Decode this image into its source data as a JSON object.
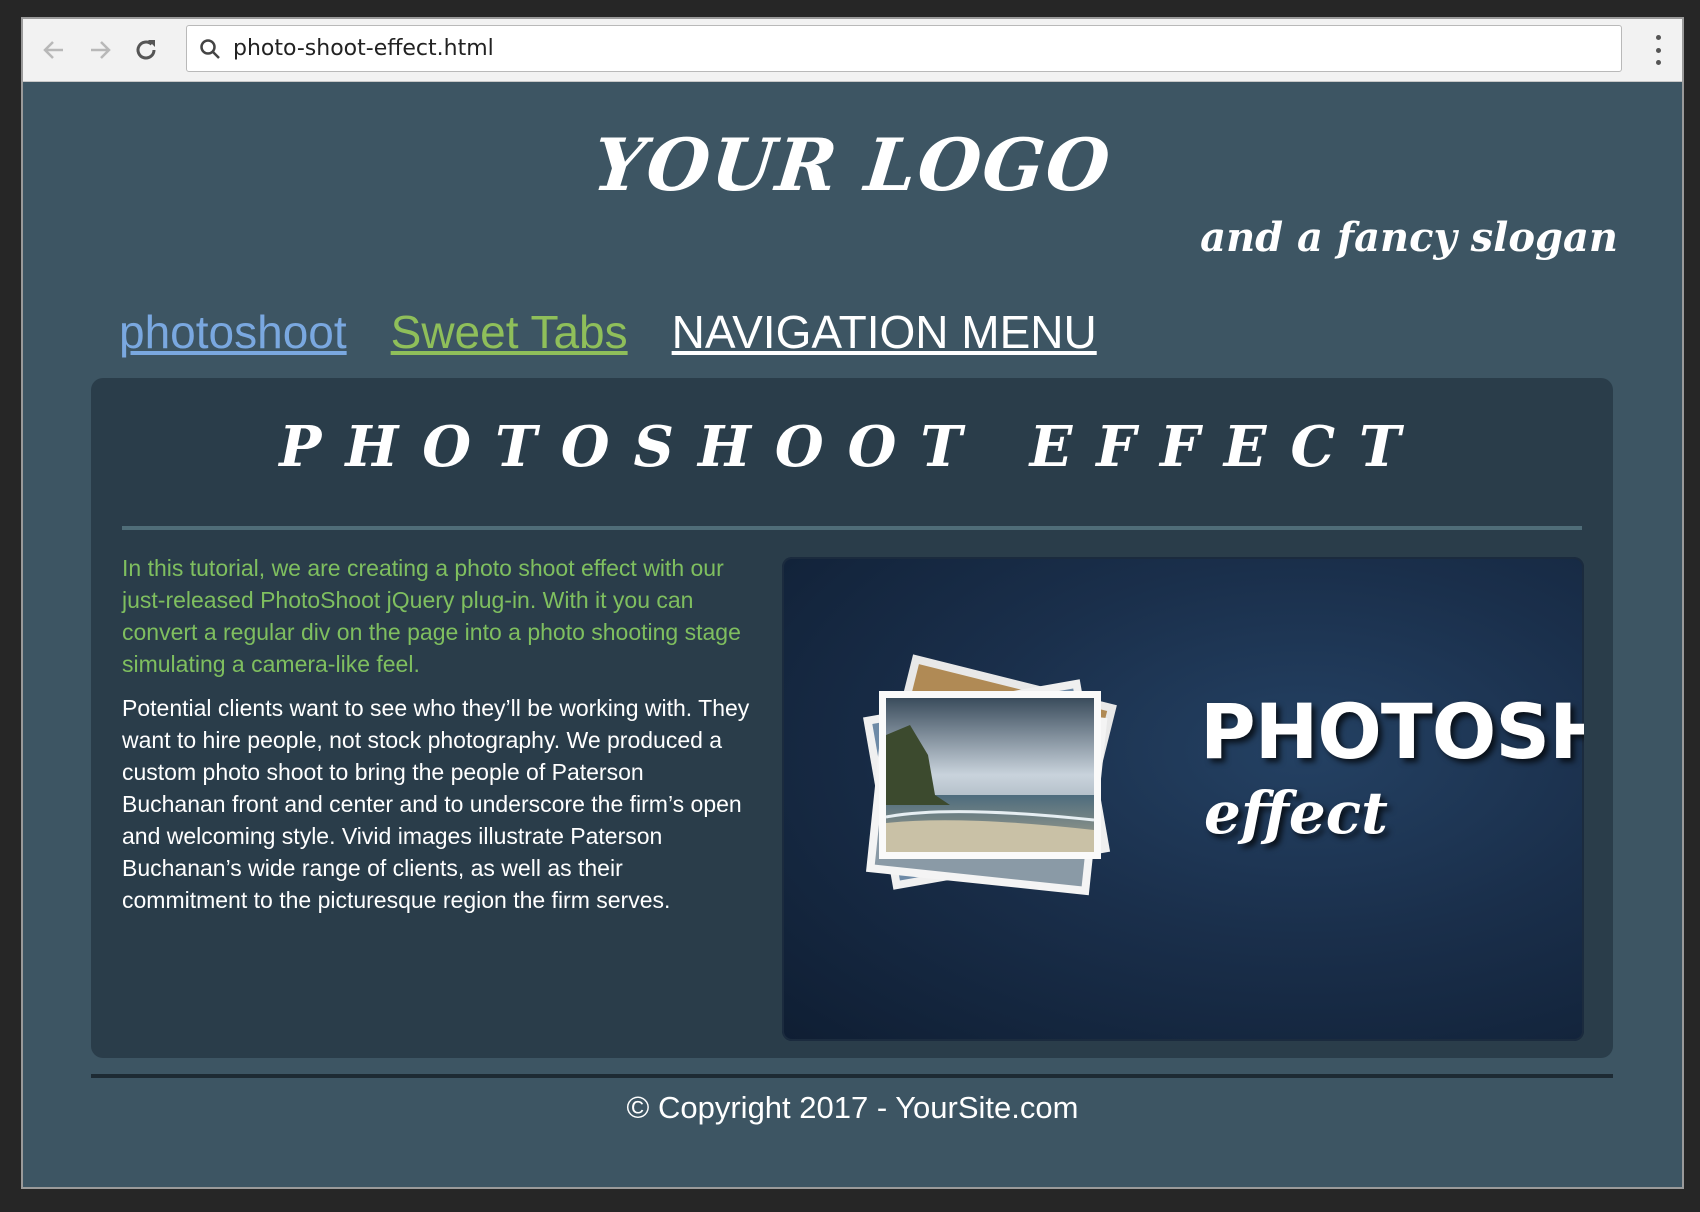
{
  "browser": {
    "url": "photo-shoot-effect.html",
    "icons": [
      "back-arrow-icon",
      "forward-arrow-icon",
      "reload-icon",
      "search-icon",
      "kebab-menu-icon"
    ]
  },
  "header": {
    "logo": "YOUR LOGO",
    "slogan": "and a fancy slogan"
  },
  "nav": {
    "items": [
      {
        "label": "photoshoot",
        "color": "#7aa8e0"
      },
      {
        "label": "Sweet Tabs",
        "color": "#8fbf5a"
      },
      {
        "label": "NAVIGATION MENU",
        "color": "#ffffff"
      }
    ]
  },
  "main": {
    "title": "PHOTOSHOOT EFFECT",
    "intro": "In this tutorial, we are creating a photo shoot effect with our just-released PhotoShoot jQuery plug-in. With it you can convert a regular div on the page into a photo shooting stage simulating a camera-like feel.",
    "body": "Potential clients want to see who they’ll be working with. They want to hire people, not stock photography. We produced a custom photo shoot to bring the people of Paterson Buchanan front and center and to underscore the firm’s open and welcoming style. Vivid images illustrate Paterson Buchanan’s wide range of clients, as well as their commitment to the picturesque region the firm serves.",
    "promo": {
      "title": "PHOTOSHOOT",
      "subtitle": "effect"
    }
  },
  "footer": {
    "copyright": "© Copyright 2017 - YourSite.com"
  },
  "colors": {
    "page_bg": "#3d5563",
    "box_bg": "#2a3d4a",
    "intro_text": "#7fbf5f"
  }
}
